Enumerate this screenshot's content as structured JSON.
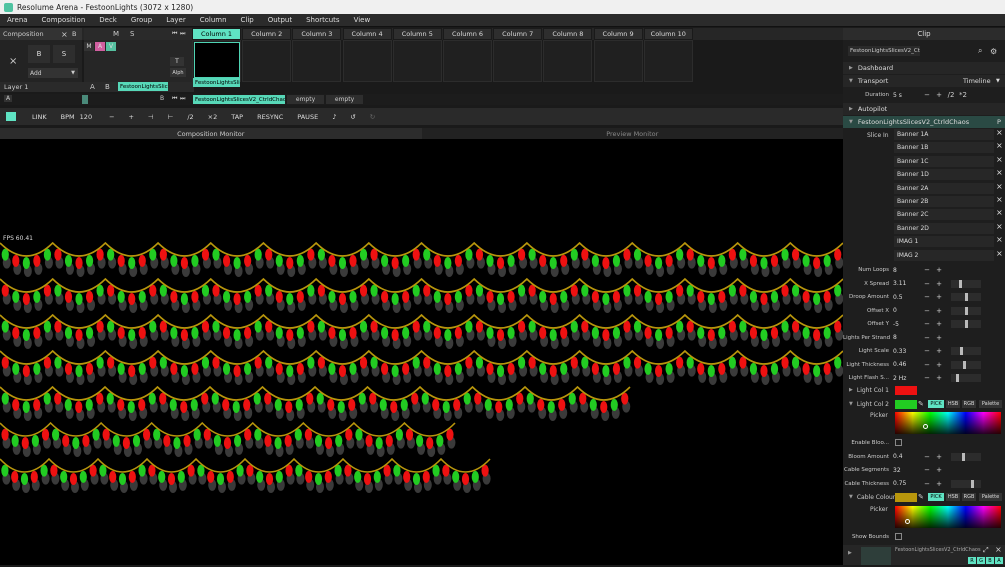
{
  "window": {
    "title": "Resolume Arena - FestoonLights (3072 x 1280)"
  },
  "menu": [
    "Arena",
    "Composition",
    "Deck",
    "Group",
    "Layer",
    "Column",
    "Clip",
    "Output",
    "Shortcuts",
    "View"
  ],
  "composition": {
    "label": "Composition",
    "b": "B",
    "add": "Add",
    "layer": "Layer 1",
    "col_btns": [
      "M",
      "A",
      "V",
      "M",
      "S",
      "T",
      "Alph"
    ],
    "ab": [
      "A",
      "B"
    ],
    "b_label": "B",
    "s_label": "S"
  },
  "columns": [
    "Column 1",
    "Column 2",
    "Column 3",
    "Column 4",
    "Column 5",
    "Column 6",
    "Column 7",
    "Column 8",
    "Column 9",
    "Column 10"
  ],
  "clips": {
    "layer_clip": "FestoonLightsSlic...",
    "col1_clip": "FestoonLightsSlic...",
    "deck": [
      "FestoonLightsSlicesV2_CtrldChaos",
      "empty",
      "empty"
    ],
    "deck_a": "A",
    "deck_b": "B"
  },
  "transport": {
    "link": "LINK",
    "bpm_label": "BPM",
    "bpm": "120",
    "minus": "−",
    "plus": "+",
    "div2": "/2",
    "x2": "×2",
    "tap": "TAP",
    "resync": "RESYNC",
    "pause": "PAUSE"
  },
  "monitors": {
    "composition": "Composition Monitor",
    "preview": "Preview Monitor",
    "fps": "FPS 60.41"
  },
  "clip_panel": {
    "header": "Clip",
    "clip_name": "FestoonLightsSlicesV2_CtrldC...",
    "dashboard": "Dashboard",
    "transport": "Transport",
    "timeline": "Timeline",
    "duration_label": "Duration",
    "duration": "5 s",
    "dur_div": "/2",
    "dur_mul": "*2",
    "autopilot": "Autopilot",
    "effect": "FestoonLightsSlicesV2_CtrldChaos",
    "effect_p": "P",
    "slice_label": "Slice In",
    "slices": [
      "Banner 1A",
      "Banner 1B",
      "Banner 1C",
      "Banner 1D",
      "Banner 2A",
      "Banner 2B",
      "Banner 2C",
      "Banner 2D",
      "IMAG 1",
      "IMAG 2"
    ],
    "params": [
      {
        "label": "Num Loops",
        "value": "8",
        "level": 0
      },
      {
        "label": "X Spread",
        "value": "3.11",
        "level": 0.3
      },
      {
        "label": "Droop Amount",
        "value": "0.5",
        "level": 0.5
      },
      {
        "label": "Offset X",
        "value": "0",
        "level": 0.5
      },
      {
        "label": "Offset Y",
        "value": "-5",
        "level": 0.5
      },
      {
        "label": "Lights Per Strand",
        "value": "8",
        "level": 0
      },
      {
        "label": "Light Scale",
        "value": "0.33",
        "level": 0.33
      },
      {
        "label": "Light Thickness",
        "value": "0.46",
        "level": 0.46
      },
      {
        "label": "Light Flash S...",
        "value": "2 Hz",
        "level": 0.2
      }
    ],
    "light_col1": "Light Col 1",
    "light_col2": "Light Col 2",
    "col1": "#ee1111",
    "col2": "#22cc22",
    "cable_col": "#b8960c",
    "pick": "PICK",
    "hsb": "HSB",
    "rgb": "RGB",
    "palette": "Palette",
    "picker": "Picker",
    "params2": [
      {
        "label": "Enable Bloo...",
        "type": "check"
      },
      {
        "label": "Bloom Amount",
        "value": "0.4",
        "level": 0.4
      },
      {
        "label": "Cable Segments",
        "value": "32",
        "level": 0
      },
      {
        "label": "Cable Thickness",
        "value": "0.75",
        "level": 0.75
      }
    ],
    "cable_colour": "Cable Colour",
    "show_bounds": "Show Bounds",
    "footer_clip": "FestoonLightsSlicesV2_CtrldChaos",
    "rgba": [
      "R",
      "G",
      "B",
      "A"
    ]
  },
  "festoon": {
    "strands": [
      {
        "w": 843,
        "loops": 16
      },
      {
        "w": 843,
        "loops": 16
      },
      {
        "w": 843,
        "loops": 16
      },
      {
        "w": 843,
        "loops": 16
      },
      {
        "w": 630,
        "loops": 12
      },
      {
        "w": 455,
        "loops": 9
      },
      {
        "w": 490,
        "loops": 10
      }
    ]
  }
}
